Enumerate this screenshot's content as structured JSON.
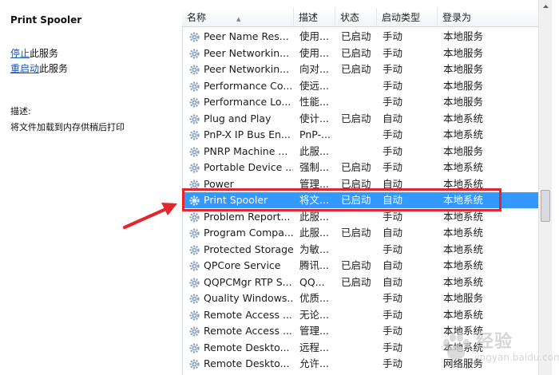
{
  "details": {
    "title": "Print Spooler",
    "stop_link": "停止",
    "stop_suffix": "此服务",
    "restart_link": "重启动",
    "restart_suffix": "此服务",
    "desc_label": "描述:",
    "desc_text": "将文件加载到内存供稍后打印"
  },
  "columns": {
    "name": "名称",
    "desc": "描述",
    "status": "状态",
    "startup": "启动类型",
    "logon": "登录为"
  },
  "rows": [
    {
      "name": "Peer Name Res...",
      "desc": "使用...",
      "status": "已启动",
      "startup": "手动",
      "logon": "本地服务"
    },
    {
      "name": "Peer Networkin...",
      "desc": "使用...",
      "status": "已启动",
      "startup": "手动",
      "logon": "本地服务"
    },
    {
      "name": "Peer Networkin...",
      "desc": "向对...",
      "status": "已启动",
      "startup": "手动",
      "logon": "本地服务"
    },
    {
      "name": "Performance Co...",
      "desc": "使远...",
      "status": "",
      "startup": "手动",
      "logon": "本地服务"
    },
    {
      "name": "Performance Lo...",
      "desc": "性能...",
      "status": "",
      "startup": "手动",
      "logon": "本地服务"
    },
    {
      "name": "Plug and Play",
      "desc": "使计...",
      "status": "已启动",
      "startup": "自动",
      "logon": "本地系统"
    },
    {
      "name": "PnP-X IP Bus En...",
      "desc": "PnP-...",
      "status": "",
      "startup": "手动",
      "logon": "本地系统"
    },
    {
      "name": "PNRP Machine ...",
      "desc": "此服...",
      "status": "",
      "startup": "手动",
      "logon": "本地服务"
    },
    {
      "name": "Portable Device ...",
      "desc": "强制...",
      "status": "已启动",
      "startup": "手动",
      "logon": "本地系统"
    },
    {
      "name": "Power",
      "desc": "管理...",
      "status": "已启动",
      "startup": "自动",
      "logon": "本地系统"
    },
    {
      "name": "Print Spooler",
      "desc": "将文...",
      "status": "已启动",
      "startup": "自动",
      "logon": "本地系统"
    },
    {
      "name": "Problem Report...",
      "desc": "此服...",
      "status": "",
      "startup": "手动",
      "logon": "本地系统"
    },
    {
      "name": "Program Compa...",
      "desc": "此服...",
      "status": "已启动",
      "startup": "自动",
      "logon": "本地系统"
    },
    {
      "name": "Protected Storage",
      "desc": "为敏...",
      "status": "",
      "startup": "手动",
      "logon": "本地系统"
    },
    {
      "name": "QPCore Service",
      "desc": "腾讯...",
      "status": "已启动",
      "startup": "自动",
      "logon": "本地系统"
    },
    {
      "name": "QQPCMgr RTP S...",
      "desc": "QQ...",
      "status": "已启动",
      "startup": "自动",
      "logon": "本地系统"
    },
    {
      "name": "Quality Windows...",
      "desc": "优质...",
      "status": "",
      "startup": "手动",
      "logon": "本地服务"
    },
    {
      "name": "Remote Access ...",
      "desc": "无论...",
      "status": "",
      "startup": "手动",
      "logon": "本地系统"
    },
    {
      "name": "Remote Access ...",
      "desc": "管理...",
      "status": "",
      "startup": "手动",
      "logon": "本地系统"
    },
    {
      "name": "Remote Deskto...",
      "desc": "远程...",
      "status": "",
      "startup": "手动",
      "logon": "本地系统"
    },
    {
      "name": "Remote Deskto...",
      "desc": "允许...",
      "status": "",
      "startup": "手动",
      "logon": "网络服务"
    }
  ],
  "selected_row": "Print Spooler",
  "watermark": {
    "text": "经验",
    "url": "jingyan.baidu.com"
  },
  "colors": {
    "selection": "#3399ff",
    "highlight_box": "#e3262b",
    "link": "#1a55b8"
  }
}
